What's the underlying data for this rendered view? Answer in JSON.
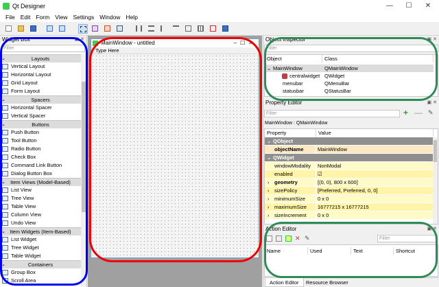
{
  "app": {
    "title": "Qt Designer"
  },
  "window_buttons": {
    "minimize": "—",
    "maximize": "☐",
    "close": "✕"
  },
  "menu": [
    "File",
    "Edit",
    "Form",
    "View",
    "Settings",
    "Window",
    "Help"
  ],
  "widget_box": {
    "title": "Widget Box",
    "filter_placeholder": "Filter",
    "sections": [
      {
        "label": "Layouts",
        "items": [
          "Vertical Layout",
          "Horizontal Layout",
          "Grid Layout",
          "Form Layout"
        ]
      },
      {
        "label": "Spacers",
        "items": [
          "Horizontal Spacer",
          "Vertical Spacer"
        ]
      },
      {
        "label": "Buttons",
        "items": [
          "Push Button",
          "Tool Button",
          "Radio Button",
          "Check Box",
          "Command Link Button",
          "Dialog Button Box"
        ]
      },
      {
        "label": "Item Views (Model-Based)",
        "items": [
          "List View",
          "Tree View",
          "Table View",
          "Column View",
          "Undo View"
        ]
      },
      {
        "label": "Item Widgets (Item-Based)",
        "items": [
          "List Widget",
          "Tree Widget",
          "Table Widget"
        ]
      },
      {
        "label": "Containers",
        "items": [
          "Group Box",
          "Scroll Area"
        ]
      }
    ]
  },
  "form": {
    "title": "MainWindow - untitled",
    "menu_placeholder": "Type Here"
  },
  "object_inspector": {
    "title": "Object Inspector",
    "filter_placeholder": "Filter",
    "col_object": "Object",
    "col_class": "Class",
    "rows": [
      {
        "object": "MainWindow",
        "class": "QMainWindow"
      },
      {
        "object": "centralwidget",
        "class": "QWidget"
      },
      {
        "object": "menubar",
        "class": "QMenuBar"
      },
      {
        "object": "statusbar",
        "class": "QStatusBar"
      }
    ]
  },
  "property_editor": {
    "title": "Property Editor",
    "filter_placeholder": "Filter",
    "context": "MainWindow : QMainWindow",
    "col_property": "Property",
    "col_value": "Value",
    "rows": [
      {
        "group": "QObject"
      },
      {
        "name": "objectName",
        "value": "MainWindow"
      },
      {
        "group": "QWidget"
      },
      {
        "name": "windowModality",
        "value": "NonModal"
      },
      {
        "name": "enabled",
        "value": "☑"
      },
      {
        "name": "geometry",
        "value": "[(0, 0), 800 x 600]"
      },
      {
        "name": "sizePolicy",
        "value": "[Preferred, Preferred, 0, 0]"
      },
      {
        "name": "minimumSize",
        "value": "0 x 0"
      },
      {
        "name": "maximumSize",
        "value": "16777215 x 16777215"
      },
      {
        "name": "sizeIncrement",
        "value": "0 x 0"
      }
    ]
  },
  "action_editor": {
    "title": "Action Editor",
    "filter_placeholder": "Filter",
    "col_name": "Name",
    "col_used": "Used",
    "col_text": "Text",
    "col_shortcut": "Shortcut"
  },
  "tabs": [
    "Action Editor",
    "Resource Browser"
  ],
  "colors": {
    "blue_highlight": "#0000ee",
    "red_highlight": "#ee0000",
    "green_highlight": "#2e8b57"
  }
}
